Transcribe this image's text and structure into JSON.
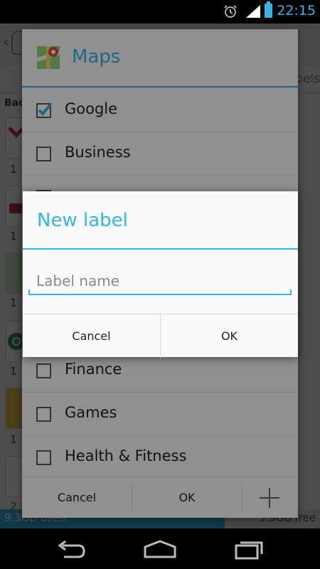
{
  "status_bar": {
    "time": "22:15",
    "accent": "#33b5e5",
    "icons": [
      "alarm-icon",
      "signal-icon",
      "battery-icon"
    ]
  },
  "background_app": {
    "tab_partial": "bels",
    "section_partial": "Bac",
    "counts": [
      "1",
      "1",
      "1",
      "1",
      "1",
      "2"
    ],
    "storage_used": "9.3GB used",
    "storage_free": "5.9GB free"
  },
  "labels_dialog": {
    "title": "Maps",
    "items": [
      {
        "label": "Google",
        "checked": true
      },
      {
        "label": "Business",
        "checked": false
      },
      {
        "label": "",
        "checked": false
      },
      {
        "label": "",
        "checked": false
      },
      {
        "label": "",
        "checked": false
      },
      {
        "label": "Finance",
        "checked": false
      },
      {
        "label": "Games",
        "checked": false
      },
      {
        "label": "Health & Fitness",
        "checked": false
      }
    ],
    "cancel_label": "Cancel",
    "ok_label": "OK",
    "add_icon": "plus-icon"
  },
  "new_label_dialog": {
    "title": "New label",
    "input_value": "",
    "input_placeholder": "Label name",
    "cancel_label": "Cancel",
    "ok_label": "OK"
  },
  "nav_bar": {
    "icons": [
      "back-icon",
      "home-icon",
      "recent-apps-icon"
    ]
  }
}
